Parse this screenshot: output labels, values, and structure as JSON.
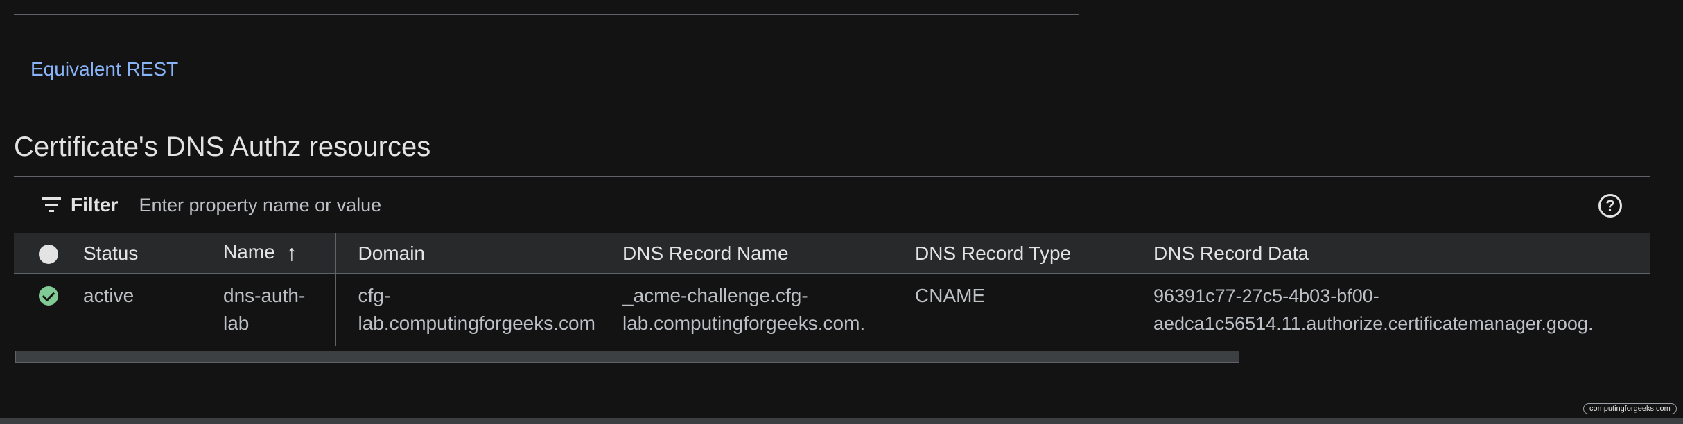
{
  "rest_link": "Equivalent REST",
  "section_title": "Certificate's DNS Authz resources",
  "filter": {
    "label": "Filter",
    "placeholder": "Enter property name or value"
  },
  "icons": {
    "filter": "filter-icon",
    "help": "help-icon",
    "select_all": "select-all-circle-icon",
    "status_active": "check-circle-icon",
    "sort": "arrow-up-icon"
  },
  "table": {
    "headers": {
      "status": "Status",
      "name": "Name",
      "domain": "Domain",
      "record_name": "DNS Record Name",
      "record_type": "DNS Record Type",
      "record_data": "DNS Record Data"
    },
    "rows": [
      {
        "status": "active",
        "name": "dns-auth-lab",
        "domain": "cfg-lab.computingforgeeks.com",
        "record_name": "_acme-challenge.cfg-lab.computingforgeeks.com.",
        "record_type": "CNAME",
        "record_data": "96391c77-27c5-4b03-bf00-aedca1c56514.11.authorize.certificatemanager.goog."
      }
    ]
  },
  "watermark": "computingforgeeks.com",
  "colors": {
    "background": "#131314",
    "link": "#8ab4f8",
    "header_bg": "#28292a",
    "status_active": "#81c995"
  }
}
